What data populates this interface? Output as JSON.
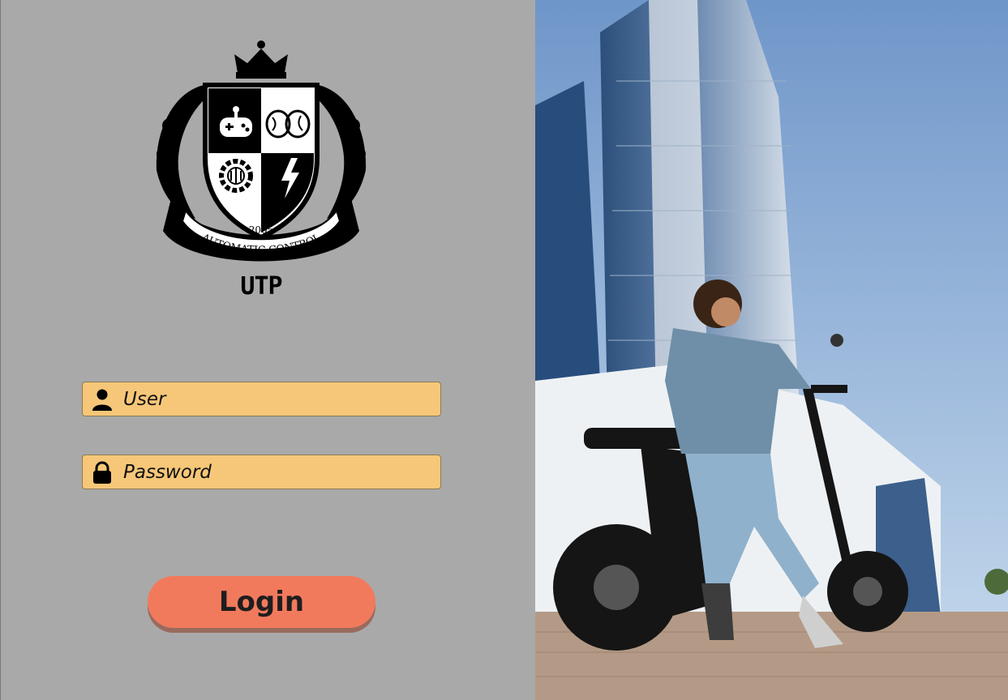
{
  "crest": {
    "year": "2005",
    "motto": "AUTOMATIC CONTROL",
    "brand": "UTP"
  },
  "form": {
    "user_placeholder": "User",
    "password_placeholder": "Password",
    "login_label": "Login"
  },
  "colors": {
    "panel_bg": "#a9a9a9",
    "field_bg": "#f6c778",
    "button_bg": "#f27a5c"
  },
  "icons": {
    "user": "user-icon",
    "password": "lock-icon"
  }
}
